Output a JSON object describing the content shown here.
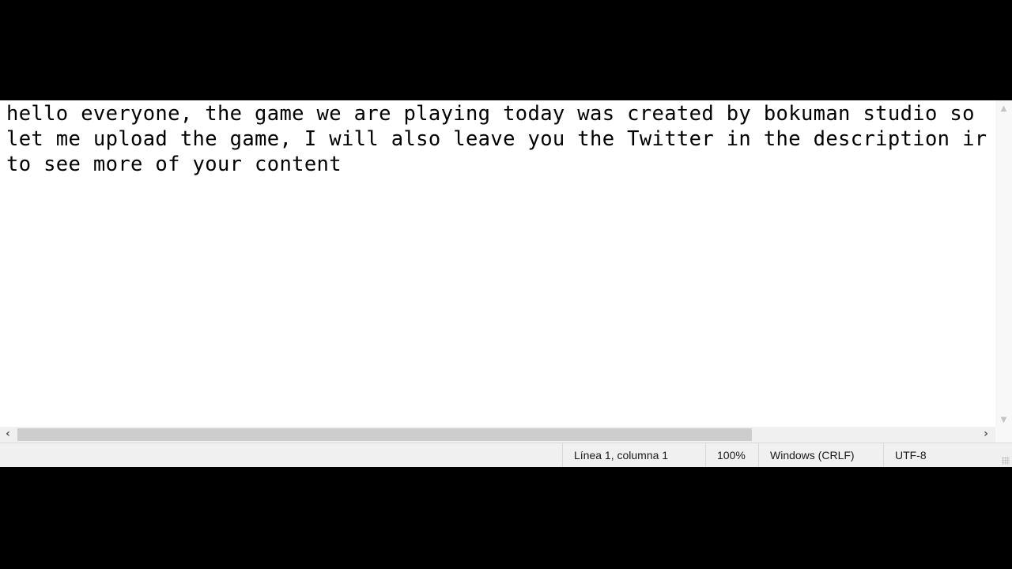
{
  "editor": {
    "lines": [
      "hello everyone, the game we are playing today was created by bokuman studio so",
      "let me upload the game, I will also leave you the Twitter in the description ir",
      "to see more of your content"
    ]
  },
  "scrollbars": {
    "vertical": {
      "up_icon": "▲",
      "down_icon": "▼"
    },
    "horizontal": {
      "left_icon": "‹",
      "right_icon": "›",
      "thumb_fraction": 0.765,
      "position_fraction": 0.0
    }
  },
  "statusbar": {
    "position": "Línea 1, columna 1",
    "zoom": "100%",
    "line_ending": "Windows (CRLF)",
    "encoding": "UTF-8"
  }
}
